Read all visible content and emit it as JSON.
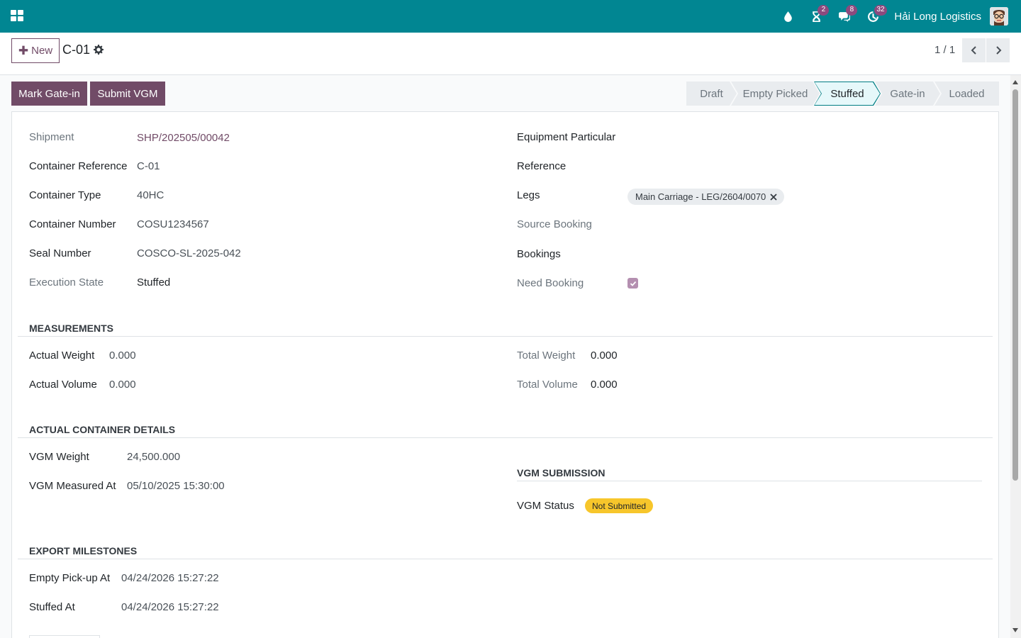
{
  "navbar": {
    "company": "Hải Long Logistics",
    "activity_badge": "2",
    "messages_badge": "8",
    "timer_badge": "32"
  },
  "control": {
    "new_label": "New",
    "record_title": "C-01",
    "pager": "1 / 1"
  },
  "actions": {
    "mark_gate_in": "Mark Gate-in",
    "submit_vgm": "Submit VGM"
  },
  "stages": [
    "Draft",
    "Empty Picked",
    "Stuffed",
    "Gate-in",
    "Loaded"
  ],
  "active_stage": "Stuffed",
  "left_fields": [
    {
      "label": "Shipment",
      "value": "SHP/202505/00042"
    },
    {
      "label": "Container Reference",
      "value": "C-01"
    },
    {
      "label": "Container Type",
      "value": "40HC"
    },
    {
      "label": "Container Number",
      "value": "COSU1234567"
    },
    {
      "label": "Seal Number",
      "value": "COSCO-SL-2025-042"
    },
    {
      "label": "Execution State",
      "value": "Stuffed"
    }
  ],
  "right_fields": [
    {
      "label": "Equipment Particular"
    },
    {
      "label": "Reference"
    },
    {
      "label": "Legs",
      "tag": "Main Carriage - LEG/2604/0070"
    },
    {
      "label": "Source Booking"
    },
    {
      "label": "Bookings"
    },
    {
      "label": "Need Booking",
      "checked": true
    }
  ],
  "measurements": {
    "title": "MEASUREMENTS",
    "actual_weight_label": "Actual Weight",
    "actual_weight": "0.000",
    "actual_volume_label": "Actual Volume",
    "actual_volume": "0.000",
    "total_weight_label": "Total Weight",
    "total_weight": "0.000",
    "total_volume_label": "Total Volume",
    "total_volume": "0.000"
  },
  "container_details": {
    "title": "ACTUAL CONTAINER DETAILS",
    "vgm_weight_label": "VGM Weight",
    "vgm_weight": "24,500.000",
    "vgm_measured_label": "VGM Measured At",
    "vgm_measured": "05/10/2025 15:30:00"
  },
  "vgm_submission": {
    "title": "VGM SUBMISSION",
    "status_label": "VGM Status",
    "status": "Not Submitted"
  },
  "milestones": {
    "title": "EXPORT MILESTONES",
    "empty_pickup_label": "Empty Pick-up At",
    "empty_pickup": "04/24/2026 15:27:22",
    "stuffed_label": "Stuffed At",
    "stuffed": "04/24/2026 15:27:22"
  },
  "colors": {
    "navbar": "#018692",
    "primary": "#714b67",
    "status_warning": "#f7c62b"
  }
}
